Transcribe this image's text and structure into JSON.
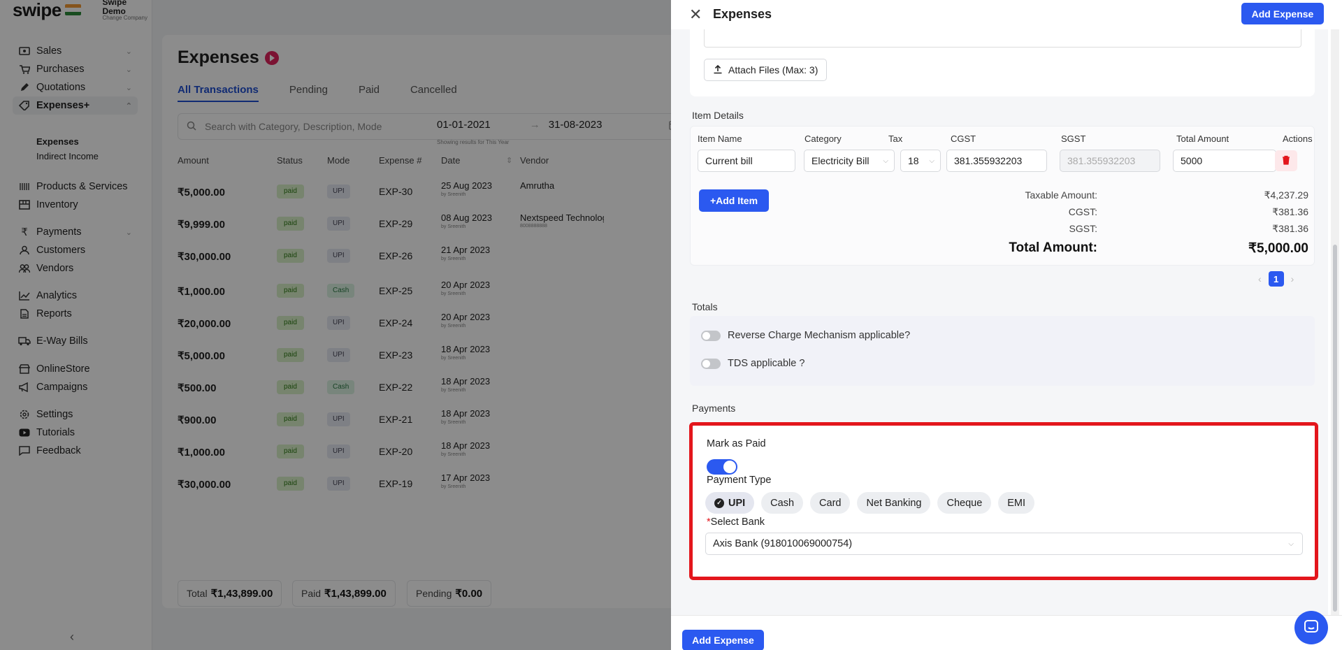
{
  "app": {
    "logo_text": "swipe",
    "company_name": "Swipe Demo",
    "company_sub": "Change Company"
  },
  "sidebar": {
    "items": [
      {
        "label": "Sales",
        "icon": "sales-icon"
      },
      {
        "label": "Purchases",
        "icon": "cart-icon"
      },
      {
        "label": "Quotations",
        "icon": "pen-icon"
      },
      {
        "label": "Expenses+",
        "icon": "tag-icon"
      },
      {
        "label": "Products & Services",
        "icon": "barcode-icon"
      },
      {
        "label": "Inventory",
        "icon": "inventory-icon"
      },
      {
        "label": "Payments",
        "icon": "rupee-icon"
      },
      {
        "label": "Customers",
        "icon": "user-icon"
      },
      {
        "label": "Vendors",
        "icon": "users-icon"
      },
      {
        "label": "Analytics",
        "icon": "chart-icon"
      },
      {
        "label": "Reports",
        "icon": "report-icon"
      },
      {
        "label": "E-Way Bills",
        "icon": "truck-icon"
      },
      {
        "label": "OnlineStore",
        "icon": "store-icon"
      },
      {
        "label": "Campaigns",
        "icon": "megaphone-icon"
      },
      {
        "label": "Settings",
        "icon": "gear-icon"
      },
      {
        "label": "Tutorials",
        "icon": "youtube-icon"
      },
      {
        "label": "Feedback",
        "icon": "message-icon"
      }
    ],
    "sub_items": [
      "Expenses",
      "Indirect Income"
    ]
  },
  "main": {
    "title": "Expenses",
    "tabs": [
      "All Transactions",
      "Pending",
      "Paid",
      "Cancelled"
    ],
    "search_placeholder": "Search with Category, Description, Mode",
    "date_from": "01-01-2021",
    "date_to": "31-08-2023",
    "date_hint": "Showing results for This Year",
    "columns": [
      "Amount",
      "Status",
      "Mode",
      "Expense #",
      "Date",
      "Vendor"
    ],
    "rows": [
      {
        "amount": "₹5,000.00",
        "status": "paid",
        "mode": "UPI",
        "expense": "EXP-30",
        "date": "25 Aug 2023",
        "by": "by Sreenith",
        "vendor": "Amrutha",
        "vendor_sub": ""
      },
      {
        "amount": "₹9,999.00",
        "status": "paid",
        "mode": "UPI",
        "expense": "EXP-29",
        "date": "08 Aug 2023",
        "by": "by Sreenith",
        "vendor": "Nextspeed Technologies",
        "vendor_sub": "8008888888"
      },
      {
        "amount": "₹30,000.00",
        "status": "paid",
        "mode": "UPI",
        "expense": "EXP-26",
        "date": "21 Apr 2023",
        "by": "by Sreenith",
        "vendor": "",
        "vendor_sub": ""
      },
      {
        "amount": "₹1,000.00",
        "status": "paid",
        "mode": "Cash",
        "expense": "EXP-25",
        "date": "20 Apr 2023",
        "by": "by Sreenith",
        "vendor": "",
        "vendor_sub": ""
      },
      {
        "amount": "₹20,000.00",
        "status": "paid",
        "mode": "UPI",
        "expense": "EXP-24",
        "date": "20 Apr 2023",
        "by": "by Sreenith",
        "vendor": "",
        "vendor_sub": ""
      },
      {
        "amount": "₹5,000.00",
        "status": "paid",
        "mode": "UPI",
        "expense": "EXP-23",
        "date": "18 Apr 2023",
        "by": "by Sreenith",
        "vendor": "",
        "vendor_sub": ""
      },
      {
        "amount": "₹500.00",
        "status": "paid",
        "mode": "Cash",
        "expense": "EXP-22",
        "date": "18 Apr 2023",
        "by": "by Sreenith",
        "vendor": "",
        "vendor_sub": ""
      },
      {
        "amount": "₹900.00",
        "status": "paid",
        "mode": "UPI",
        "expense": "EXP-21",
        "date": "18 Apr 2023",
        "by": "by Sreenith",
        "vendor": "",
        "vendor_sub": ""
      },
      {
        "amount": "₹1,000.00",
        "status": "paid",
        "mode": "UPI",
        "expense": "EXP-20",
        "date": "18 Apr 2023",
        "by": "by Sreenith",
        "vendor": "",
        "vendor_sub": ""
      },
      {
        "amount": "₹30,000.00",
        "status": "paid",
        "mode": "UPI",
        "expense": "EXP-19",
        "date": "17 Apr 2023",
        "by": "by Sreenith",
        "vendor": "",
        "vendor_sub": ""
      }
    ],
    "summary": {
      "total_label": "Total",
      "total_value": "₹1,43,899.00",
      "paid_label": "Paid",
      "paid_value": "₹1,43,899.00",
      "pending_label": "Pending",
      "pending_value": "₹0.00"
    }
  },
  "drawer": {
    "title": "Expenses",
    "header_button": "Add Expense",
    "attach_label": "Attach Files (Max: 3)",
    "item_details_title": "Item Details",
    "item_columns": [
      "Item Name",
      "Category",
      "Tax",
      "CGST",
      "SGST",
      "Total Amount",
      "Actions"
    ],
    "item": {
      "name": "Current bill",
      "category": "Electricity Bill",
      "tax": "18",
      "cgst": "381.355932203",
      "sgst": "381.355932203",
      "total": "5000"
    },
    "add_item_label": "+Add Item",
    "totals_rows": [
      {
        "label": "Taxable Amount:",
        "value": "₹4,237.29"
      },
      {
        "label": "CGST:",
        "value": "₹381.36"
      },
      {
        "label": "SGST:",
        "value": "₹381.36"
      },
      {
        "label": "Total Amount:",
        "value": "₹5,000.00"
      }
    ],
    "current_page": "1",
    "totals_title": "Totals",
    "reverse_charge_label": "Reverse Charge Mechanism applicable?",
    "tds_label": "TDS applicable ?",
    "payments_title": "Payments",
    "mark_paid_label": "Mark as Paid",
    "mark_paid_on": true,
    "payment_type_label": "Payment Type",
    "payment_types": [
      "UPI",
      "Cash",
      "Card",
      "Net Banking",
      "Cheque",
      "EMI"
    ],
    "selected_payment_type": "UPI",
    "select_bank_label": "Select Bank",
    "selected_bank": "Axis Bank (918010069000754)",
    "footer_button": "Add Expense"
  },
  "colors": {
    "primary": "#2b59f0",
    "highlight_border": "#e3161c",
    "paid_badge": "#d9f0c8"
  }
}
